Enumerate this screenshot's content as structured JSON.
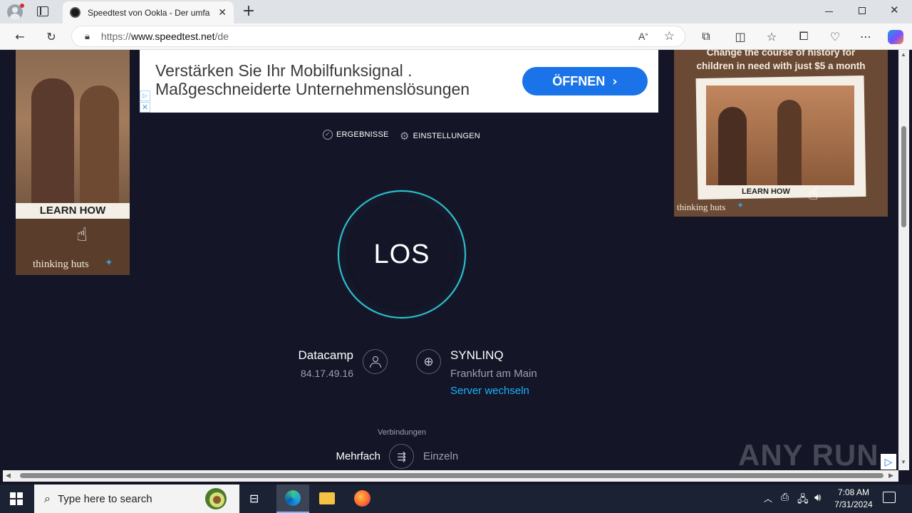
{
  "browser": {
    "tab_title": "Speedtest von Ookla - Der umfa",
    "url_prefix": "https://",
    "url_domain": "www.speedtest.net",
    "url_path": "/de"
  },
  "ad_top": {
    "line1": "Verstärken Sie Ihr Mobilfunksignal .",
    "line2": "Maßgeschneiderte Unternehmenslösungen",
    "button": "ÖFFNEN"
  },
  "ad_left": {
    "cta": "LEARN HOW",
    "brand": "thinking huts"
  },
  "ad_right": {
    "headline1": "Change the course of history for",
    "headline2": "children in need with just $5 a month",
    "cta": "LEARN HOW",
    "brand": "thinking huts"
  },
  "nav": {
    "results": "ERGEBNISSE",
    "settings": "EINSTELLUNGEN"
  },
  "go_button": "LOS",
  "isp": {
    "name": "Datacamp",
    "ip": "84.17.49.16"
  },
  "server": {
    "name": "SYNLINQ",
    "location": "Frankfurt am Main",
    "change": "Server wechseln"
  },
  "connections": {
    "label": "Verbindungen",
    "multi": "Mehrfach",
    "single": "Einzeln"
  },
  "watermark": "ANY RUN",
  "taskbar": {
    "search_placeholder": "Type here to search",
    "time": "7:08 AM",
    "date": "7/31/2024"
  },
  "colors": {
    "page_bg": "#141526",
    "accent_teal": "#2ec5d3",
    "link_blue": "#1ab2ff",
    "ad_button": "#1a73e8"
  }
}
